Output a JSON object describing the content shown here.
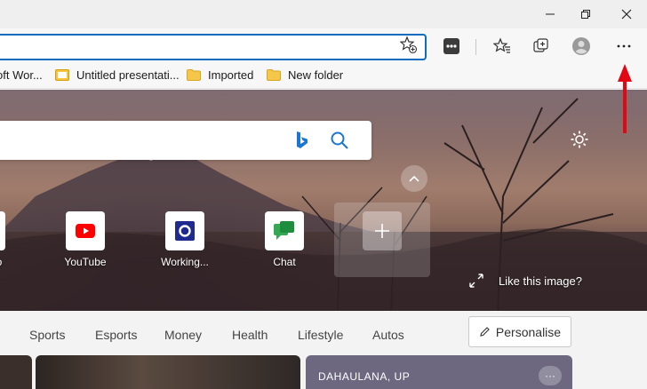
{
  "favorites": [
    {
      "label": "oft Wor...",
      "icon": "word-doc-icon"
    },
    {
      "label": "Untitled presentati...",
      "icon": "slides-icon"
    },
    {
      "label": "Imported",
      "icon": "folder-icon"
    },
    {
      "label": "New folder",
      "icon": "folder-icon"
    }
  ],
  "quick_links": [
    {
      "label": "YouTube",
      "icon": "youtube-icon"
    },
    {
      "label": "Working...",
      "icon": "office-icon"
    },
    {
      "label": "Chat",
      "icon": "chat-icon"
    }
  ],
  "partial_link_label": "o",
  "like_image": "Like this image?",
  "nav": [
    "Sports",
    "Esports",
    "Money",
    "Health",
    "Lifestyle",
    "Autos"
  ],
  "personalise": "Personalise",
  "card_location": "DAHAULANA, UP",
  "more": "···",
  "colors": {
    "accent": "#0f6cbd",
    "annotation_arrow": "#e30613",
    "youtube": "#ff0000",
    "office": "#1e2a8c",
    "chat": "#34a853"
  }
}
